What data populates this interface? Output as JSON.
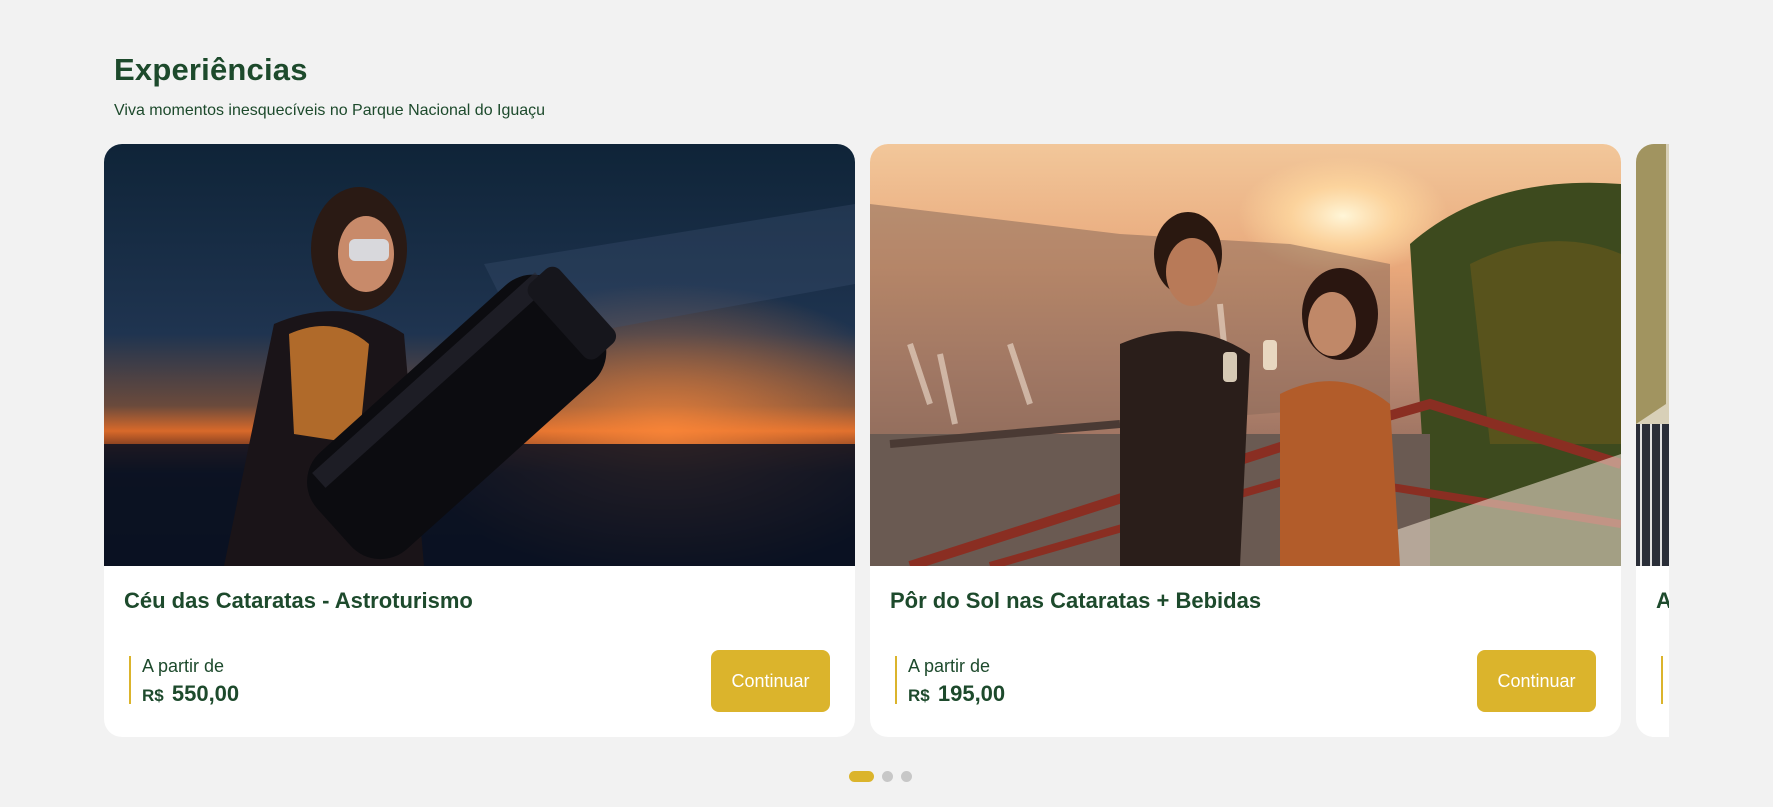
{
  "section": {
    "title": "Experiências",
    "subtitle": "Viva momentos inesquecíveis no Parque Nacional do Iguaçu"
  },
  "cards": [
    {
      "title": "Céu das Cataratas - Astroturismo",
      "price_prefix": "A partir de",
      "currency": "R$",
      "price": "550,00",
      "button_label": "Continuar",
      "image_subject": "woman looking through telescope at dusk"
    },
    {
      "title": "Pôr do Sol nas Cataratas + Bebidas",
      "price_prefix": "A partir de",
      "currency": "R$",
      "price": "195,00",
      "button_label": "Continuar",
      "image_subject": "couple toasting at sunset over waterfalls"
    },
    {
      "title": "A",
      "price_prefix": "",
      "currency": "",
      "price": "",
      "button_label": "",
      "image_subject": "partially visible waterfall view"
    }
  ],
  "pagination": {
    "total": 3,
    "active": 1
  },
  "colors": {
    "brand_green": "#1d4a2c",
    "accent_gold": "#dbb42c",
    "background": "#f2f2f2",
    "dot_inactive": "#c7c7c7"
  }
}
